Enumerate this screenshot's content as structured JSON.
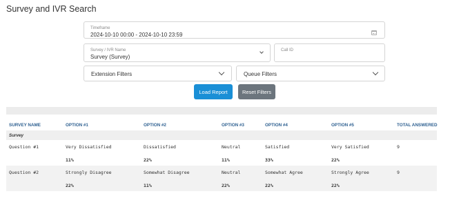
{
  "page": {
    "title": "Survey and IVR Search"
  },
  "filters": {
    "timeframe": {
      "label": "Timeframe",
      "value": "2024-10-10 00:00 - 2024-10-10 23:59"
    },
    "survey": {
      "label": "Survey / IVR Name",
      "value": "Survey (Survey)"
    },
    "call_id": {
      "label": "Call ID",
      "value": ""
    },
    "extension_filters": "Extension Filters",
    "queue_filters": "Queue Filters"
  },
  "buttons": {
    "load": "Load Report",
    "reset": "Reset Filters"
  },
  "table": {
    "headers": [
      "SURVEY NAME",
      "OPTION #1",
      "OPTION #2",
      "OPTION #3",
      "OPTION #4",
      "OPTION #5",
      "TOTAL ANSWERED"
    ],
    "group": "Survey",
    "rows": [
      {
        "name": "Question #1",
        "options": [
          "Very Dissatisfied",
          "Dissatisfied",
          "Neutral",
          "Satisfied",
          "Very Satisfied"
        ],
        "total": "9",
        "percents": [
          "11%",
          "22%",
          "11%",
          "33%",
          "22%"
        ]
      },
      {
        "name": "Question #2",
        "options": [
          "Strongly Disagree",
          "Somewhat Disagree",
          "Neutral",
          "Somewhat Agree",
          "Strongly Agree"
        ],
        "total": "9",
        "percents": [
          "22%",
          "11%",
          "22%",
          "22%",
          "22%"
        ]
      }
    ]
  }
}
